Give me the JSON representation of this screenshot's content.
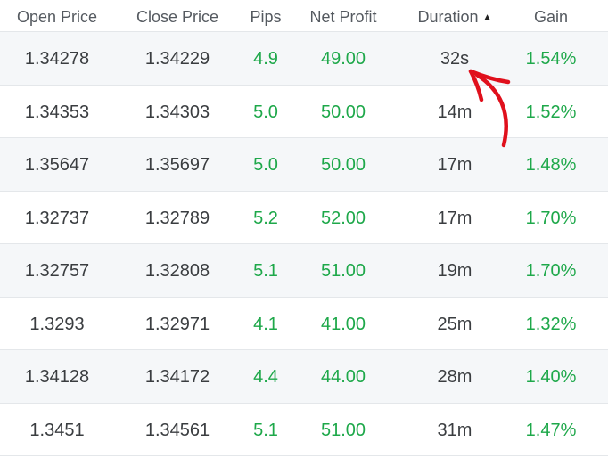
{
  "table": {
    "headers": {
      "open_price": "Open Price",
      "close_price": "Close Price",
      "pips": "Pips",
      "net_profit": "Net Profit",
      "duration": "Duration",
      "gain": "Gain"
    },
    "sort": {
      "column": "duration",
      "direction": "ascending",
      "icon": "sort-up-triangle"
    },
    "rows": [
      {
        "open_price": "1.34278",
        "close_price": "1.34229",
        "pips": "4.9",
        "net_profit": "49.00",
        "duration": "32s",
        "gain": "1.54%"
      },
      {
        "open_price": "1.34353",
        "close_price": "1.34303",
        "pips": "5.0",
        "net_profit": "50.00",
        "duration": "14m",
        "gain": "1.52%"
      },
      {
        "open_price": "1.35647",
        "close_price": "1.35697",
        "pips": "5.0",
        "net_profit": "50.00",
        "duration": "17m",
        "gain": "1.48%"
      },
      {
        "open_price": "1.32737",
        "close_price": "1.32789",
        "pips": "5.2",
        "net_profit": "52.00",
        "duration": "17m",
        "gain": "1.70%"
      },
      {
        "open_price": "1.32757",
        "close_price": "1.32808",
        "pips": "5.1",
        "net_profit": "51.00",
        "duration": "19m",
        "gain": "1.70%"
      },
      {
        "open_price": "1.3293",
        "close_price": "1.32971",
        "pips": "4.1",
        "net_profit": "41.00",
        "duration": "25m",
        "gain": "1.32%"
      },
      {
        "open_price": "1.34128",
        "close_price": "1.34172",
        "pips": "4.4",
        "net_profit": "44.00",
        "duration": "28m",
        "gain": "1.40%"
      },
      {
        "open_price": "1.3451",
        "close_price": "1.34561",
        "pips": "5.1",
        "net_profit": "51.00",
        "duration": "31m",
        "gain": "1.47%"
      }
    ]
  },
  "colors": {
    "positive": "#1ea84a",
    "text": "#3a3d40",
    "header_text": "#555a60",
    "row_alt_background": "#f5f7f9",
    "divider": "#e4e7ea",
    "annotation_arrow": "#e0101c"
  },
  "annotation": {
    "icon": "red-curved-arrow",
    "target": "duration of first row"
  }
}
